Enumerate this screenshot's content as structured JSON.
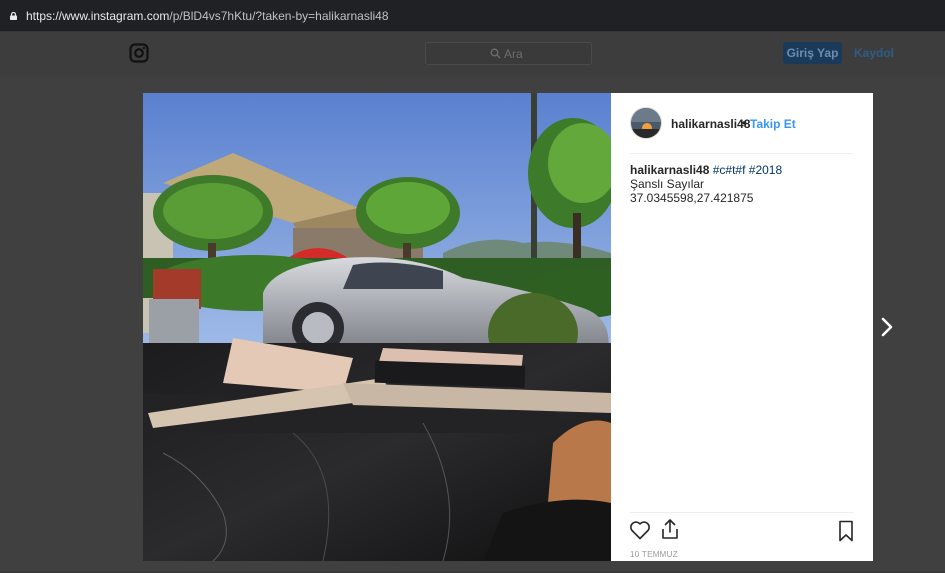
{
  "browser": {
    "url_host": "https://www.instagram.com",
    "url_path": "/p/BlD4vs7hKtu/?taken-by=halikarnasli48"
  },
  "header": {
    "logo_icon": "instagram-camera-icon",
    "search_placeholder": "Ara",
    "login_label": "Giriş Yap",
    "signup_label": "Kaydol"
  },
  "post": {
    "username": "halikarnasli48",
    "separator": "•",
    "follow_label": "Takip Et",
    "caption_user": "halikarnasli48",
    "hashtags": [
      "#c#t#f",
      "#2018"
    ],
    "caption_line1": "Şanslı Sayılar",
    "caption_line2": "37.0345598,27.421875",
    "date": "10 TEMMUZ"
  },
  "colors": {
    "overlay": "#404040",
    "link_blue": "#3897f0",
    "hashtag": "#003569"
  }
}
